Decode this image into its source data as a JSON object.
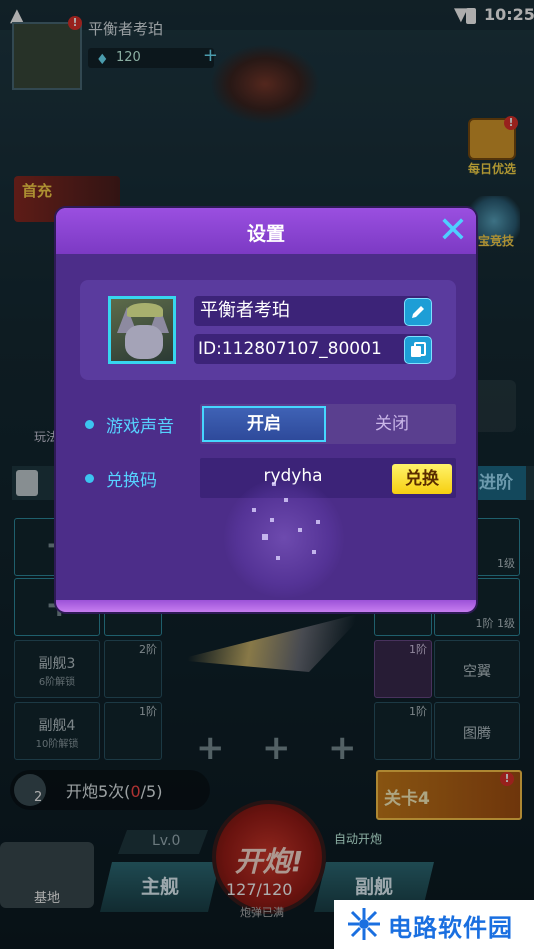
{
  "status_bar": {
    "time": "10:25"
  },
  "hud": {
    "player_name": "平衡者考珀",
    "gems": "120",
    "notice_badge": "!",
    "daily_deal_label": "每日优选",
    "arena_label": "宝竞技",
    "first_charge_label": "首充",
    "play_label": "玩法",
    "advance_label": "进阶"
  },
  "slots": {
    "sub3_title": "副舰3",
    "sub3_unlock": "6阶解锁",
    "sub4_title": "副舰4",
    "sub4_unlock": "10阶解锁",
    "badge_2": "2阶",
    "badge_1": "1阶",
    "r1_level": "1级",
    "r2_level": "1阶 1级",
    "wing_label": "空翼",
    "totem_label": "图腾"
  },
  "fire_count": {
    "number": "2",
    "prefix": "开炮5次(",
    "current": "0",
    "suffix": "/5)"
  },
  "level_card": "关卡4",
  "bottom": {
    "level": "Lv.0",
    "auto_fire": "自动开炮",
    "fire_button": "开炮!",
    "ammo": "127/120",
    "ammo_sub": "炮弹已满",
    "tab_base": "基地",
    "tab_main": "主舰",
    "tab_sub": "副舰"
  },
  "dialog": {
    "title": "设置",
    "player_name": "平衡者考珀",
    "player_id": "ID:112807107_80001",
    "sound_label": "游戏声音",
    "sound_on": "开启",
    "sound_off": "关闭",
    "code_label": "兑换码",
    "code_value": "rydyha",
    "redeem_button": "兑换"
  },
  "watermark": {
    "text": "电路软件园"
  },
  "colors": {
    "dialog": "#5a2f9c",
    "accent": "#4fd0ff",
    "redeem": "#f6cf10"
  }
}
